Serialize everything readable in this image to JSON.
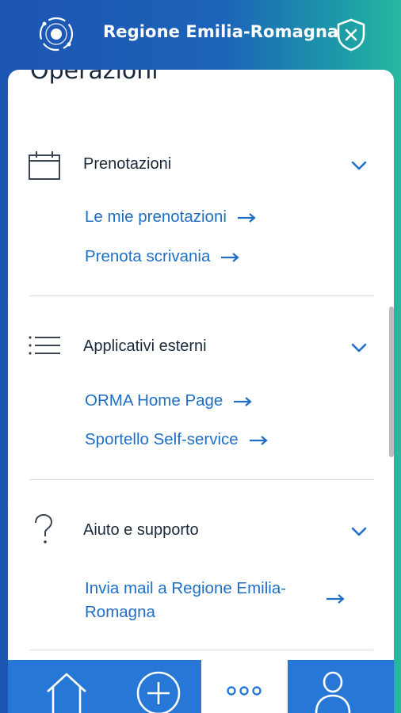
{
  "header": {
    "title": "Regione Emilia-Romagna",
    "logo_icon": "region-logo-icon",
    "close_icon": "shield-close-icon"
  },
  "panel": {
    "section_title": "Operazioni",
    "groups": [
      {
        "label": "Prenotazioni",
        "icon": "calendar-icon",
        "links": [
          "Le mie prenotazioni",
          "Prenota scrivania"
        ]
      },
      {
        "label": "Applicativi esterni",
        "icon": "list-icon",
        "links": [
          "ORMA Home Page",
          "Sportello Self-service"
        ]
      },
      {
        "label": "Aiuto e supporto",
        "icon": "question-icon",
        "links": [
          "Invia mail a Regione Emilia-Romagna"
        ],
        "link_lines": [
          "Invia mail a Regione Emilia-",
          "Romagna"
        ]
      }
    ]
  },
  "bottom_nav": {
    "items": [
      {
        "icon": "home-icon"
      },
      {
        "icon": "add-icon"
      },
      {
        "icon": "more-icon",
        "active": true
      },
      {
        "icon": "user-icon"
      }
    ]
  },
  "colors": {
    "header_gradient_start": "#1d55b3",
    "header_gradient_end": "#27b9a0",
    "link": "#1f6fc6",
    "nav": "#2778d6"
  }
}
